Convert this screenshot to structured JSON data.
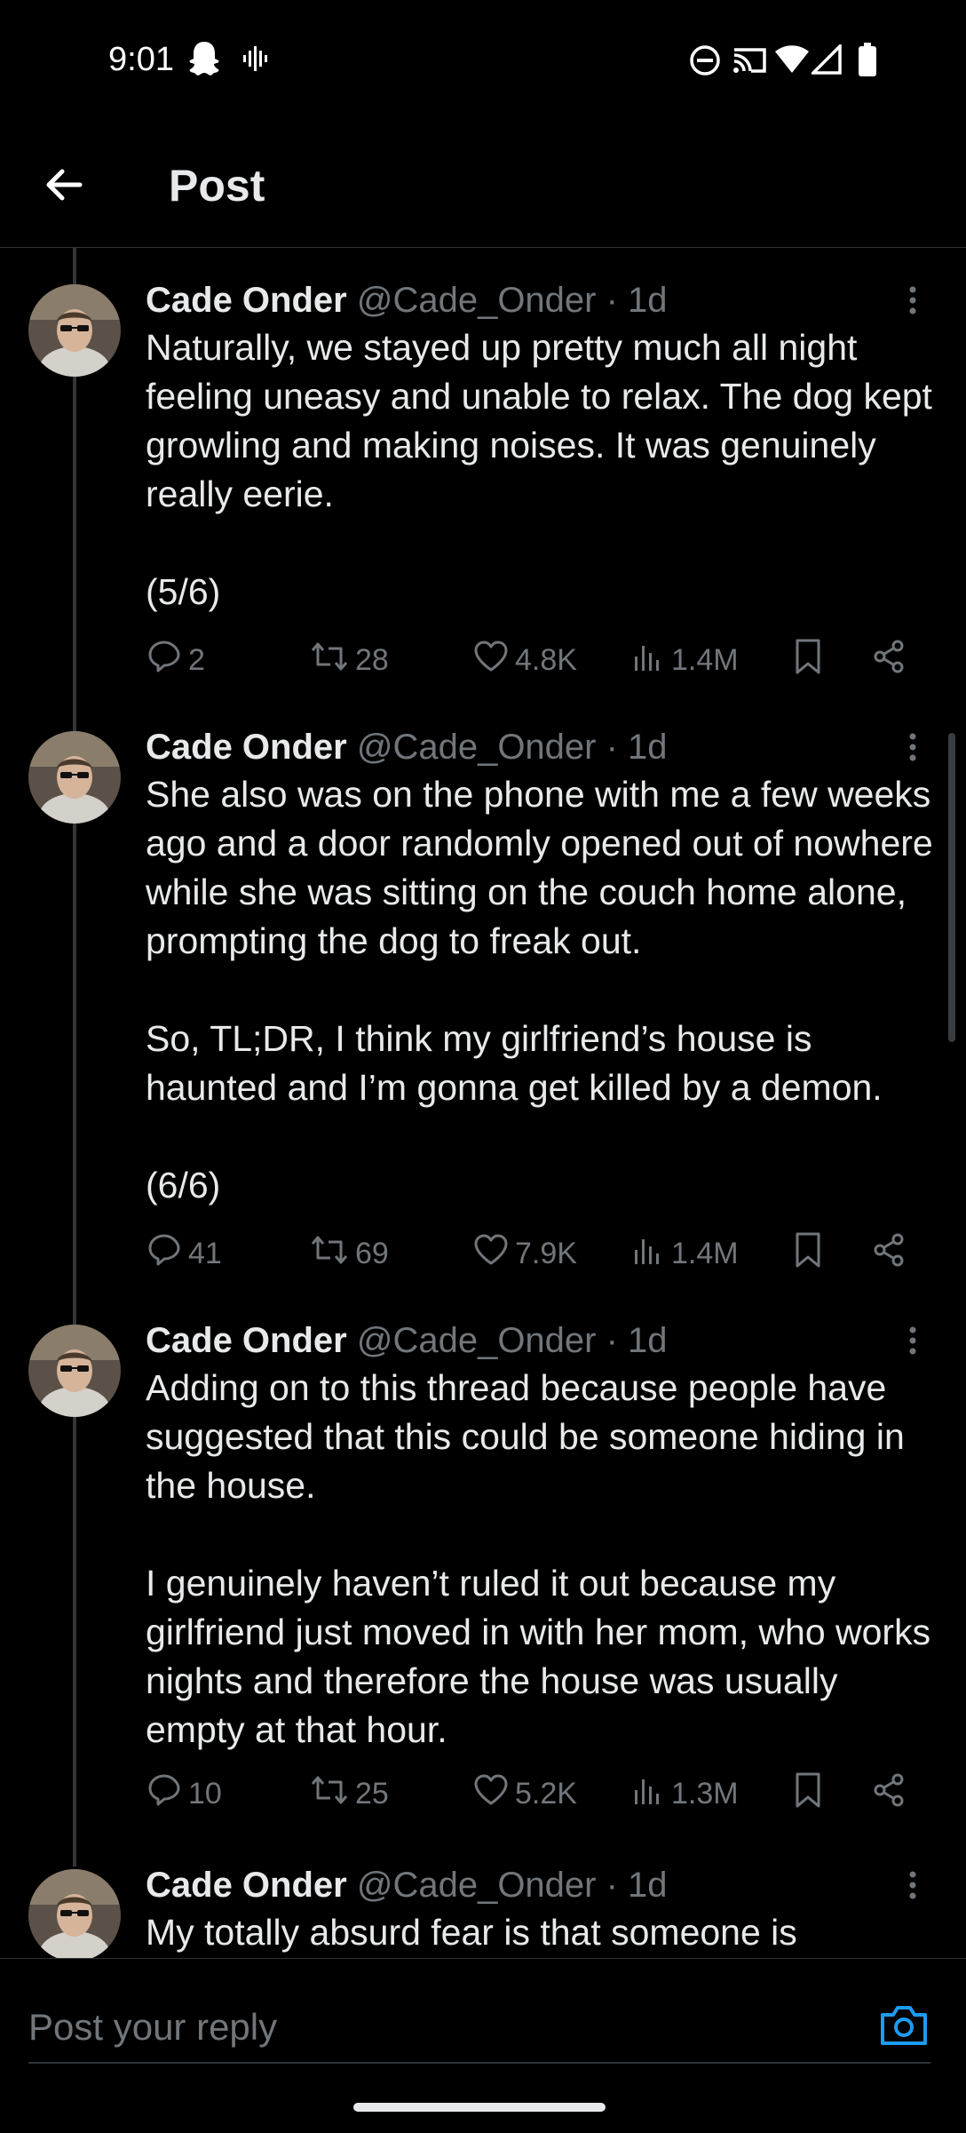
{
  "status_bar": {
    "time": "9:01",
    "icons": [
      "snapchat-icon",
      "voice-wave-icon",
      "do-not-disturb-icon",
      "cast-icon",
      "wifi-icon",
      "cellular-signal-icon",
      "battery-icon"
    ]
  },
  "header": {
    "title": "Post",
    "back_icon": "arrow-left-icon"
  },
  "posts": [
    {
      "name": "Cade Onder",
      "handle": "@Cade_Onder",
      "time": " · 1d",
      "paragraphs": [
        "Naturally, we stayed up pretty much all night feeling uneasy and unable to relax. The dog kept growling and making noises. It was genuinely really eerie.",
        "(5/6)"
      ],
      "replies": "2",
      "reposts": "28",
      "likes": "4.8K",
      "views": "1.4M"
    },
    {
      "name": "Cade Onder",
      "handle": "@Cade_Onder",
      "time": " · 1d",
      "paragraphs": [
        "She also was on the phone with me a few weeks ago and a door randomly opened out of nowhere while she was sitting on the couch home alone, prompting the dog to freak out.",
        "So, TL;DR, I think my girlfriend’s house is haunted and I’m gonna get killed by a demon.",
        "(6/6)"
      ],
      "replies": "41",
      "reposts": "69",
      "likes": "7.9K",
      "views": "1.4M"
    },
    {
      "name": "Cade Onder",
      "handle": "@Cade_Onder",
      "time": " · 1d",
      "paragraphs": [
        "Adding on to this thread because people have suggested that this could be someone hiding in the house.",
        "I genuinely haven’t ruled it out because my girlfriend just moved in with her mom, who works nights and therefore the house was usually empty at that hour."
      ],
      "replies": "10",
      "reposts": "25",
      "likes": "5.2K",
      "views": "1.3M"
    },
    {
      "name": "Cade Onder",
      "handle": "@Cade_Onder",
      "time": " · 1d",
      "paragraphs": [
        "My totally absurd fear is that someone is"
      ]
    }
  ],
  "reply_bar": {
    "placeholder": "Post your reply",
    "camera_icon": "camera-icon"
  },
  "colors": {
    "background": "#000000",
    "text": "#e7e9ea",
    "secondary": "#71767b",
    "accent": "#1d9bf0",
    "divider": "#2f3336"
  }
}
